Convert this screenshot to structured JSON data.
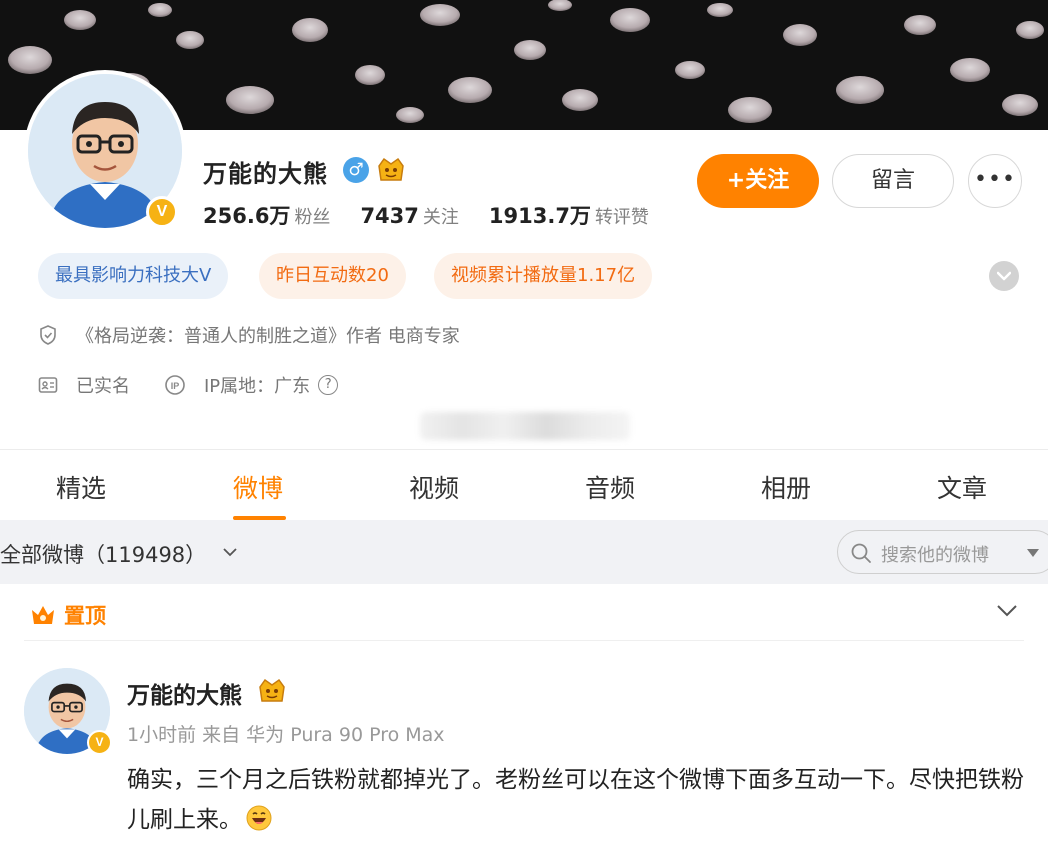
{
  "profile": {
    "name": "万能的大熊",
    "gender_symbol": "♂",
    "verified_mark": "V",
    "stats": [
      {
        "value": "256.6万",
        "label": "粉丝"
      },
      {
        "value": "7437",
        "label": "关注"
      },
      {
        "value": "1913.7万",
        "label": "转评赞"
      }
    ]
  },
  "actions": {
    "follow_label": "+关注",
    "message_label": "留言",
    "more_label": "•••"
  },
  "tags": [
    {
      "label": "最具影响力科技大V"
    },
    {
      "label": "昨日互动数20"
    },
    {
      "label": "视频累计播放量1.17亿"
    }
  ],
  "info": {
    "bio": "《格局逆袭：普通人的制胜之道》作者 电商专家",
    "realname": "已实名",
    "ip_location": "IP属地：广东",
    "help_symbol": "?"
  },
  "tabs": [
    {
      "label": "精选"
    },
    {
      "label": "微博",
      "active": true
    },
    {
      "label": "视频"
    },
    {
      "label": "音频"
    },
    {
      "label": "相册"
    },
    {
      "label": "文章"
    }
  ],
  "filter": {
    "all_posts_label": "全部微博（119498）",
    "search_placeholder": "搜索他的微博"
  },
  "pinned": {
    "label": "置顶"
  },
  "post": {
    "author": "万能的大熊",
    "verified_mark": "V",
    "meta": "1小时前  来自 华为 Pura 90 Pro Max",
    "text": "确实，三个月之后铁粉就都掉光了。老粉丝可以在这个微博下面多互动一下。尽快把铁粉儿刷上来。"
  },
  "colors": {
    "accent": "#ff8200",
    "verified": "#f6b214",
    "tag_blue_text": "#3a6fc0",
    "tag_orange_text": "#f26b12"
  }
}
